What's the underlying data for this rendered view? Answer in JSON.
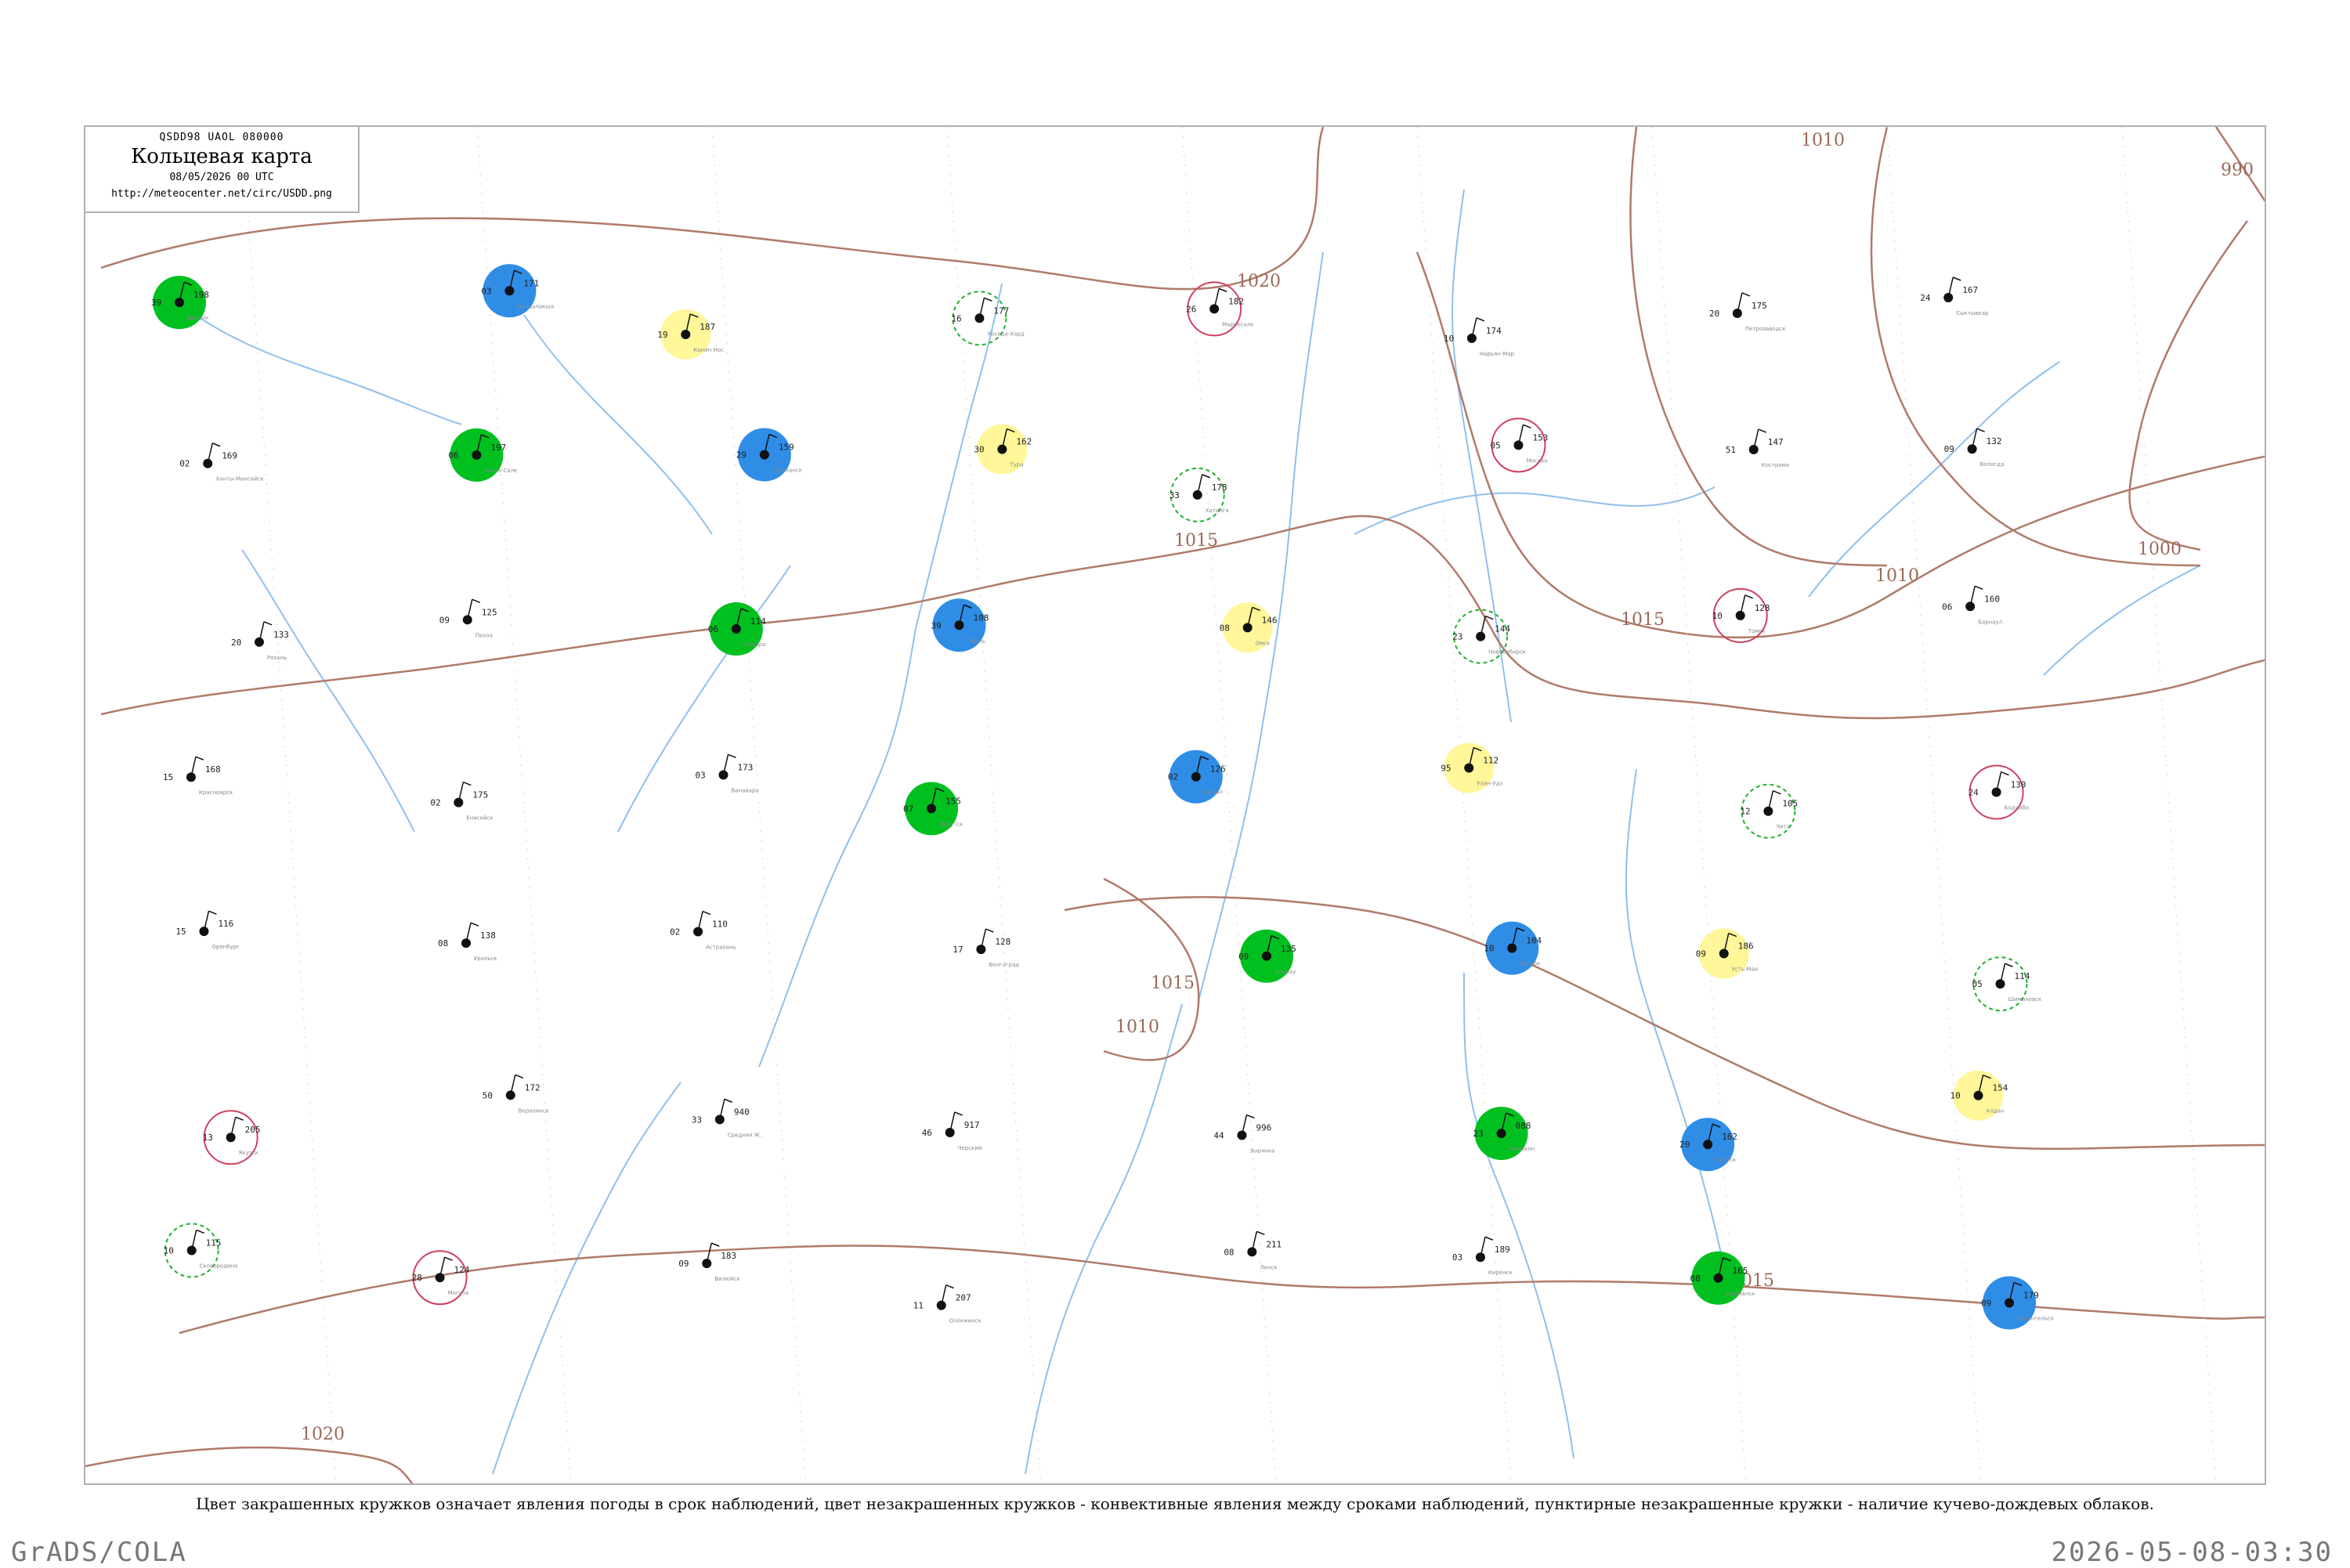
{
  "legend": {
    "code": "QSDD98  UAOL  080000",
    "title": "Кольцевая карта",
    "date": "08/05/2026 00 UTC",
    "url": "http://meteocenter.net/circ/USDD.png"
  },
  "caption": "Цвет закрашенных кружков означает явления погоды в срок наблюдений, цвет незакрашенных кружков - конвективные явления между сроками наблюдений, пунктирные незакрашенные кружки - наличие кучево-дождевых облаков.",
  "footer": {
    "left": "GrADS/COLA",
    "right": "2026-05-08-03:30"
  },
  "colors": {
    "isobar": "#b07a6a",
    "river": "#8ec0ee",
    "rain": "#00c020",
    "snow": "#2f8de6",
    "haze": "#fff799",
    "fog": "#6be0a0",
    "storm_ring": "#d04060",
    "cb_ring": "#20b030"
  },
  "isobars": [
    {
      "label": "1020"
    },
    {
      "label": "1015"
    },
    {
      "label": "1010"
    },
    {
      "label": "1000"
    },
    {
      "label": "990"
    }
  ],
  "stations": [
    {
      "t": "198",
      "d": "39",
      "n": "Диксон"
    },
    {
      "t": "171",
      "d": "03",
      "n": "Кандалакша"
    },
    {
      "t": "187",
      "d": "19",
      "n": "Канин Нос"
    },
    {
      "t": "177",
      "d": "16",
      "n": "Хоседа-Хард"
    },
    {
      "t": "182",
      "d": "26",
      "n": "Марресале"
    },
    {
      "t": "174",
      "d": "10",
      "n": "Нарьян-Мар"
    },
    {
      "t": "175",
      "d": "20",
      "n": "Петрозаводск"
    },
    {
      "t": "167",
      "d": "24",
      "n": "Сыктывкар"
    },
    {
      "t": "169",
      "d": "02",
      "n": "Ханты-Мансийск"
    },
    {
      "t": "197",
      "d": "06",
      "n": "Тарко-Сале"
    },
    {
      "t": "159",
      "d": "29",
      "n": "Туруханск"
    },
    {
      "t": "162",
      "d": "30",
      "n": "Тура"
    },
    {
      "t": "178",
      "d": "33",
      "n": "Хатанга"
    },
    {
      "t": "153",
      "d": "05",
      "n": "Москва"
    },
    {
      "t": "147",
      "d": "51",
      "n": "Кострома"
    },
    {
      "t": "132",
      "d": "09",
      "n": "Вологда"
    },
    {
      "t": "133",
      "d": "20",
      "n": "Рязань"
    },
    {
      "t": "125",
      "d": "09",
      "n": "Пенза"
    },
    {
      "t": "114",
      "d": "06",
      "n": "Самара"
    },
    {
      "t": "108",
      "d": "39",
      "n": "Пермь"
    },
    {
      "t": "146",
      "d": "08",
      "n": "Омск"
    },
    {
      "t": "144",
      "d": "23",
      "n": "Новосибирск"
    },
    {
      "t": "128",
      "d": "10",
      "n": "Томск"
    },
    {
      "t": "160",
      "d": "06",
      "n": "Барнаул"
    },
    {
      "t": "168",
      "d": "15",
      "n": "Красноярск"
    },
    {
      "t": "175",
      "d": "02",
      "n": "Енисейск"
    },
    {
      "t": "173",
      "d": "03",
      "n": "Ванавара"
    },
    {
      "t": "155",
      "d": "07",
      "n": "Иркутск"
    },
    {
      "t": "126",
      "d": "02",
      "n": "Кызыл"
    },
    {
      "t": "112",
      "d": "95",
      "n": "Улан-Удэ"
    },
    {
      "t": "105",
      "d": "12",
      "n": "Чита"
    },
    {
      "t": "130",
      "d": "24",
      "n": "Бодайбо"
    },
    {
      "t": "116",
      "d": "15",
      "n": "Оренбург"
    },
    {
      "t": "138",
      "d": "08",
      "n": "Уральск"
    },
    {
      "t": "110",
      "d": "02",
      "n": "Астрахань"
    },
    {
      "t": "128",
      "d": "17",
      "n": "Волгоград"
    },
    {
      "t": "135",
      "d": "09",
      "n": "Атырау"
    },
    {
      "t": "104",
      "d": "10",
      "n": "Актобе"
    },
    {
      "t": "186",
      "d": "09",
      "n": "Усть-Мая"
    },
    {
      "t": "114",
      "d": "05",
      "n": "Шимановск"
    },
    {
      "t": "205",
      "d": "13",
      "n": "Якутск"
    },
    {
      "t": "172",
      "d": "50",
      "n": "Верхоянск"
    },
    {
      "t": "940",
      "d": "33",
      "n": "Средняя Ж."
    },
    {
      "t": "917",
      "d": "46",
      "n": "Черский"
    },
    {
      "t": "996",
      "d": "44",
      "n": "Зырянка"
    },
    {
      "t": "088",
      "d": "23",
      "n": "Оймякон"
    },
    {
      "t": "162",
      "d": "20",
      "n": "Охотск"
    },
    {
      "t": "154",
      "d": "10",
      "n": "Алдан"
    },
    {
      "t": "115",
      "d": "10",
      "n": "Сковородино"
    },
    {
      "t": "124",
      "d": "28",
      "n": "Могоча"
    },
    {
      "t": "183",
      "d": "09",
      "n": "Вилюйск"
    },
    {
      "t": "207",
      "d": "11",
      "n": "Олёкминск"
    },
    {
      "t": "211",
      "d": "08",
      "n": "Ленск"
    },
    {
      "t": "189",
      "d": "03",
      "n": "Киренск"
    },
    {
      "t": "165",
      "d": "08",
      "n": "Мурманск"
    },
    {
      "t": "179",
      "d": "09",
      "n": "Архангельск"
    }
  ]
}
